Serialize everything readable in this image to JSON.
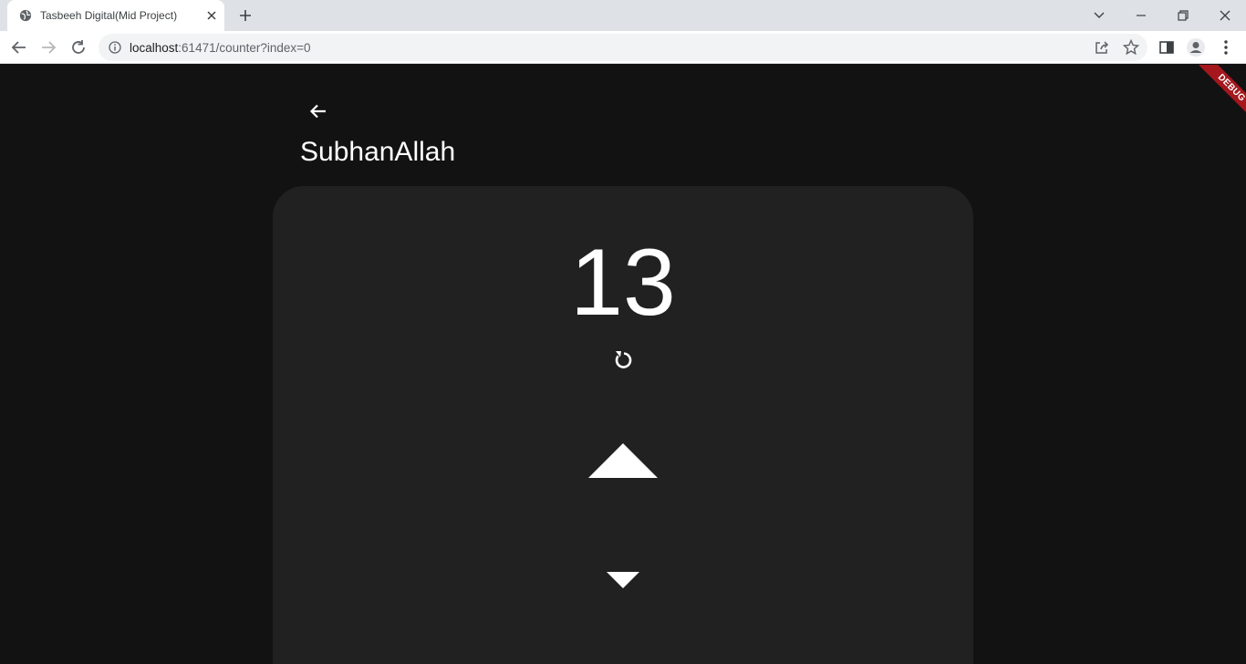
{
  "browser": {
    "tab": {
      "title": "Tasbeeh Digital(Mid Project)",
      "favicon": "globe-icon"
    },
    "url": {
      "host": "localhost",
      "path": ":61471/counter?index=0"
    },
    "window_controls": [
      "tab-search-icon",
      "minimize-icon",
      "restore-icon",
      "close-icon"
    ],
    "toolbar_icons": [
      "back-icon",
      "forward-icon",
      "reload-icon",
      "info-icon",
      "share-icon",
      "bookmark-star-icon",
      "side-panel-icon",
      "profile-icon",
      "menu-icon"
    ]
  },
  "app": {
    "title": "SubhanAllah",
    "count": "13",
    "debug_label": "DEBUG",
    "icons": {
      "back": "arrow-back-icon",
      "reset": "refresh-icon",
      "increment": "triangle-up-icon",
      "decrement": "triangle-down-icon"
    },
    "colors": {
      "background": "#121212",
      "card": "#212121",
      "foreground": "#ffffff",
      "debug_banner": "#a4171d"
    }
  }
}
